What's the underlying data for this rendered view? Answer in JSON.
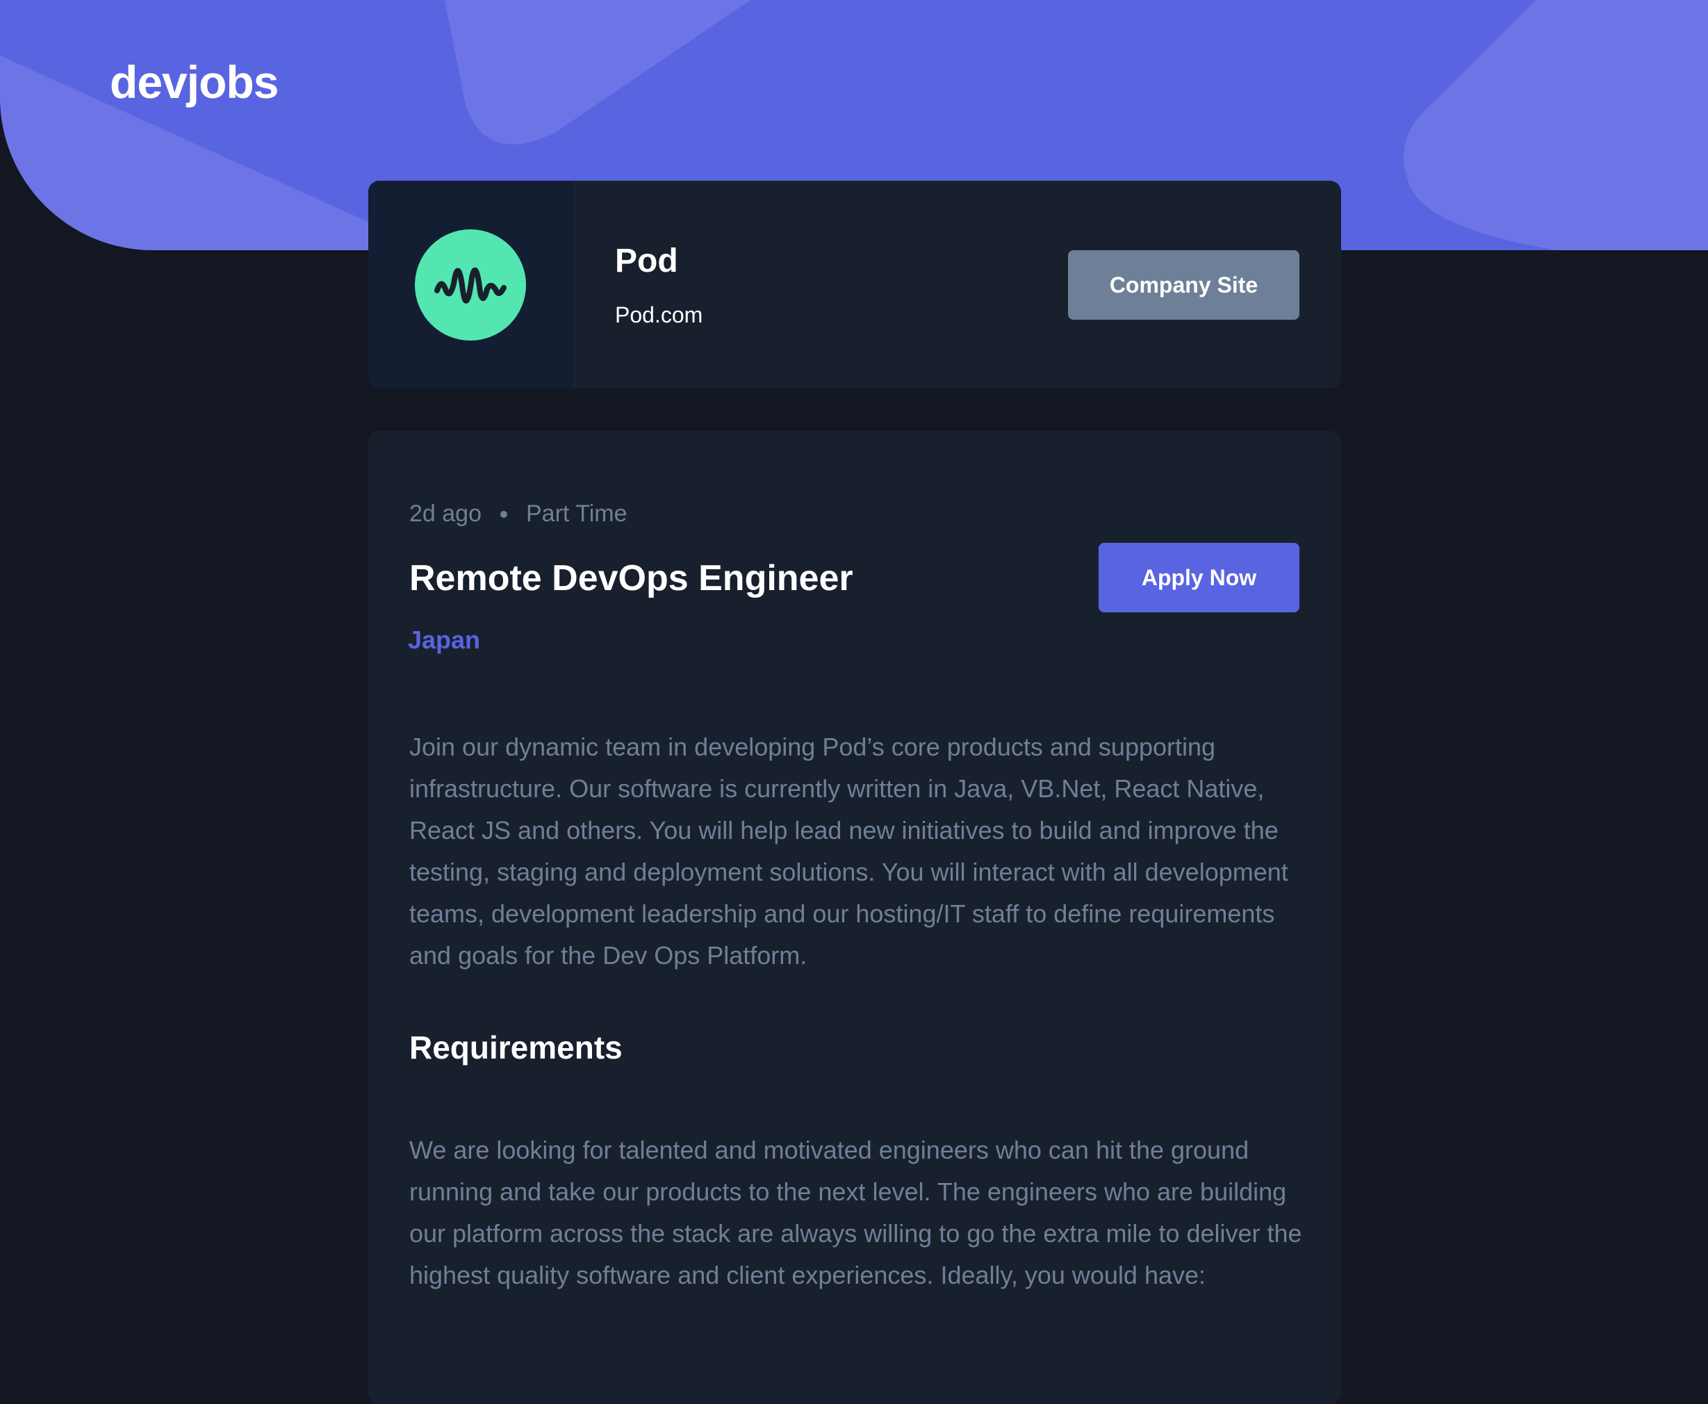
{
  "header": {
    "logo": "devjobs"
  },
  "company": {
    "name": "Pod",
    "url": "Pod.com",
    "site_button": "Company Site",
    "logo_icon": "waveform-icon",
    "logo_color": "#53E6B1"
  },
  "job": {
    "posted": "2d ago",
    "contract": "Part Time",
    "title": "Remote DevOps Engineer",
    "location": "Japan",
    "apply_button": "Apply Now",
    "description": "Join our dynamic team in developing Pod’s core products and supporting infrastructure. Our software is currently written in Java, VB.Net, React Native, React JS and others. You will help lead new initiatives to build and improve the testing, staging and deployment solutions. You will interact with all development teams, development leadership and our hosting/IT staff to define requirements and goals for the Dev Ops Platform.",
    "requirements": {
      "heading": "Requirements",
      "content": "We are looking for talented and motivated engineers who can hit the ground running and take our products to the next level. The engineers who are building our platform across the stack are always willing to go the extra mile to deliver the highest quality software and client experiences. Ideally, you would have:"
    }
  },
  "colors": {
    "brand": "#5964E0",
    "background": "#121721",
    "card": "#19202D",
    "muted_text": "#6E8098"
  }
}
